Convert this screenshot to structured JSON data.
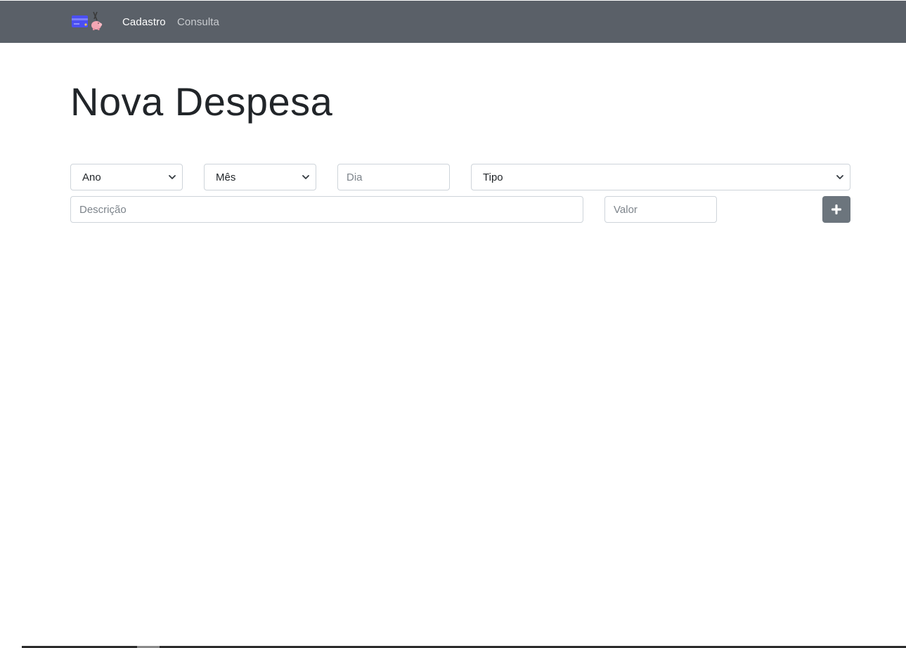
{
  "navbar": {
    "brand_icon": "credit-card-piggy-bank-icon",
    "links": [
      {
        "label": "Cadastro",
        "active": true
      },
      {
        "label": "Consulta",
        "active": false
      }
    ],
    "background_color": "#5a6068"
  },
  "main": {
    "title": "Nova Despesa"
  },
  "form": {
    "ano": {
      "selected": "Ano"
    },
    "mes": {
      "selected": "Mês"
    },
    "dia": {
      "placeholder": "Dia"
    },
    "tipo": {
      "selected": "Tipo"
    },
    "descricao": {
      "placeholder": "Descrição"
    },
    "valor": {
      "placeholder": "Valor"
    },
    "add_button": {
      "icon": "plus-icon",
      "color": "#6c757d"
    }
  }
}
